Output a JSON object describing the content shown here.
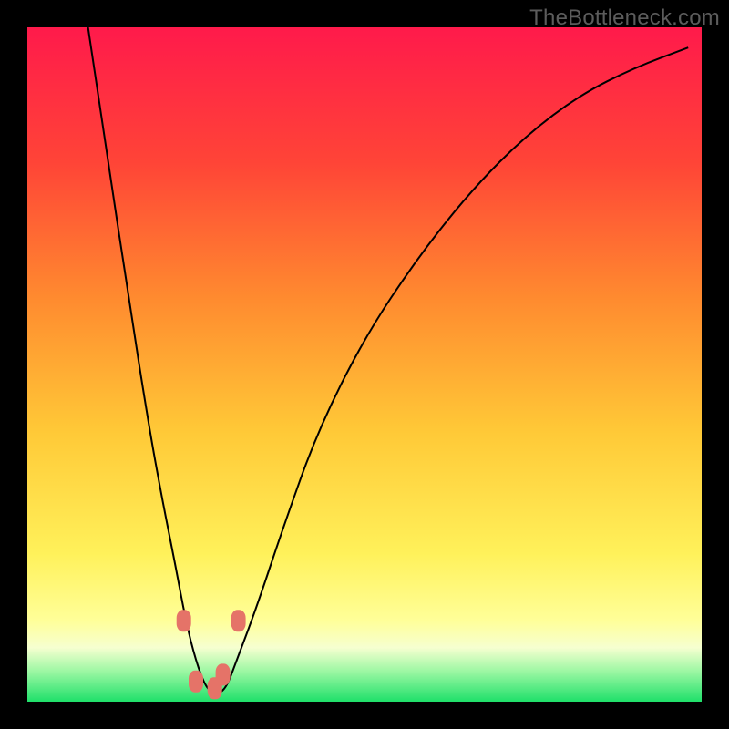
{
  "watermark": "TheBottleneck.com",
  "chart_data": {
    "type": "line",
    "title": "",
    "xlabel": "",
    "ylabel": "",
    "xlim": [
      0,
      100
    ],
    "ylim": [
      0,
      100
    ],
    "grid": false,
    "legend": false,
    "background_gradient": {
      "stops": [
        {
          "pos": 0.0,
          "color": "#ff1a4b"
        },
        {
          "pos": 0.2,
          "color": "#ff4437"
        },
        {
          "pos": 0.4,
          "color": "#ff8a2f"
        },
        {
          "pos": 0.6,
          "color": "#ffc937"
        },
        {
          "pos": 0.78,
          "color": "#fff15a"
        },
        {
          "pos": 0.88,
          "color": "#ffff99"
        },
        {
          "pos": 0.92,
          "color": "#f6ffd0"
        },
        {
          "pos": 0.955,
          "color": "#9cf7a3"
        },
        {
          "pos": 1.0,
          "color": "#1fe06a"
        }
      ]
    },
    "series": [
      {
        "name": "bottleneck-curve",
        "color": "#000000",
        "x": [
          9,
          12,
          15,
          18,
          20,
          22,
          23.5,
          25,
          26.5,
          28,
          29.5,
          31,
          34,
          38,
          43,
          50,
          58,
          66,
          74,
          82,
          90,
          98
        ],
        "y": [
          100,
          80,
          60,
          41,
          30,
          20,
          12,
          6,
          2,
          1,
          2,
          6,
          14,
          26,
          40,
          54,
          66,
          76,
          84,
          90,
          94,
          97
        ]
      }
    ],
    "markers": {
      "name": "highlight-dots",
      "color": "#e57368",
      "points": [
        {
          "x": 23.2,
          "y": 12
        },
        {
          "x": 25.0,
          "y": 3
        },
        {
          "x": 27.8,
          "y": 2
        },
        {
          "x": 29.0,
          "y": 4
        },
        {
          "x": 31.3,
          "y": 12
        }
      ]
    }
  }
}
